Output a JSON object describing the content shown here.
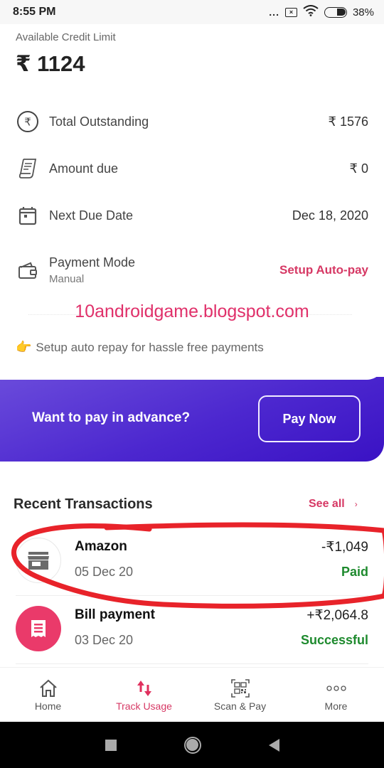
{
  "status_bar": {
    "time": "8:55 PM",
    "more_dots": "...",
    "sim_icon": "sim-x-icon",
    "wifi_icon": "wifi-icon",
    "battery_icon": "battery-icon",
    "battery_percent": "38%"
  },
  "credit": {
    "label": "Available Credit Limit",
    "value": "₹ 1124"
  },
  "info_rows": [
    {
      "icon": "rupee-circle-icon",
      "label": "Total Outstanding",
      "value": "₹ 1576"
    },
    {
      "icon": "receipt-icon",
      "label": "Amount due",
      "value": "₹ 0"
    },
    {
      "icon": "calendar-icon",
      "label": "Next Due Date",
      "value": "Dec 18, 2020"
    },
    {
      "icon": "wallet-icon",
      "label": "Payment Mode",
      "sub": "Manual",
      "action": "Setup Auto-pay"
    }
  ],
  "watermark": "10androidgame.blogspot.com",
  "tip": {
    "emoji": "👉",
    "text": "Setup auto repay for hassle free payments"
  },
  "banner": {
    "text": "Want to pay in advance?",
    "button": "Pay Now",
    "gradient_start": "#6a4bdb",
    "gradient_end": "#3a12c4"
  },
  "recent_transactions": {
    "title": "Recent Transactions",
    "see_all": "See all",
    "chevron": "›",
    "items": [
      {
        "icon": "store-icon",
        "name": "Amazon",
        "date": "05 Dec 20",
        "amount": "-₹1,049",
        "status": "Paid"
      },
      {
        "icon": "bill-icon",
        "name": "Bill payment",
        "date": "03 Dec 20",
        "amount": "+₹2,064.8",
        "status": "Successful"
      }
    ]
  },
  "bottom_nav": {
    "items": [
      {
        "icon": "home-icon",
        "label": "Home",
        "active": false
      },
      {
        "icon": "track-usage-icon",
        "label": "Track Usage",
        "active": true
      },
      {
        "icon": "qr-scan-icon",
        "label": "Scan & Pay",
        "active": false
      },
      {
        "icon": "more-icon",
        "label": "More",
        "active": false
      }
    ]
  },
  "colors": {
    "accent_pink": "#d63864",
    "success_green": "#1e8a2e",
    "annotation_red": "#e8232a"
  }
}
